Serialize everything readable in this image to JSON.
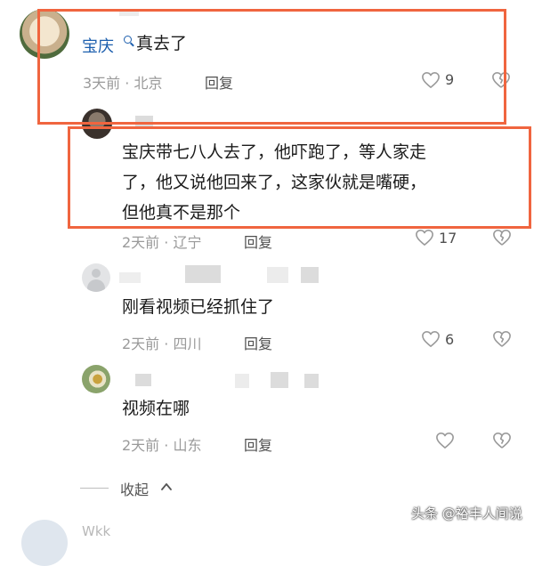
{
  "comment_main": {
    "username": "宝庆",
    "text": "真去了",
    "meta": "3天前 · 北京",
    "reply_label": "回复",
    "like_count": "9"
  },
  "replies": [
    {
      "text_lines": [
        "宝庆带七八人去了，他吓跑了，等人家走",
        "了，他又说他回来了，这家伙就是嘴硬，",
        "但他真不是那个"
      ],
      "meta": "2天前 · 辽宁",
      "reply_label": "回复",
      "like_count": "17"
    },
    {
      "text_lines": [
        "刚看视频已经抓住了"
      ],
      "meta": "2天前 · 四川",
      "reply_label": "回复",
      "like_count": "6"
    },
    {
      "text_lines": [
        "视频在哪"
      ],
      "meta": "2天前 · 山东",
      "reply_label": "回复",
      "like_count": ""
    }
  ],
  "collapse_label": "收起",
  "bottom_comment": {
    "username": "Wkk"
  },
  "watermark": "头条 @裕丰人间说",
  "colors": {
    "highlight_box": "#f0653f",
    "username_blue": "#1d5fae"
  }
}
